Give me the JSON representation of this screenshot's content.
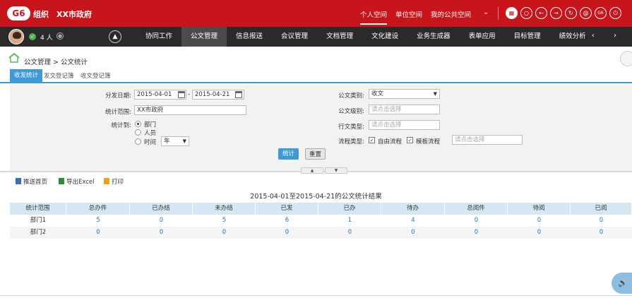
{
  "header": {
    "logo": "G6",
    "org_label": "组织",
    "org_name": "XX市政府",
    "links": [
      "个人空间",
      "单位空间",
      "我的公共空间"
    ],
    "caret": "⌄",
    "icons": [
      {
        "name": "grid-icon",
        "glyph": "▦"
      },
      {
        "name": "search-icon",
        "glyph": "○"
      },
      {
        "name": "back-icon",
        "glyph": "←"
      },
      {
        "name": "forward-icon",
        "glyph": "→"
      },
      {
        "name": "refresh-icon",
        "glyph": "↻"
      },
      {
        "name": "at-icon",
        "glyph": "@"
      },
      {
        "name": "g6-icon",
        "glyph": "G6"
      },
      {
        "name": "power-icon",
        "glyph": "⏻"
      }
    ]
  },
  "navbar": {
    "online_count": "4 人",
    "items": [
      "协同工作",
      "公文管理",
      "信息报送",
      "会议管理",
      "文档管理",
      "文化建设",
      "业务生成器",
      "表单应用",
      "目标管理",
      "绩效分析"
    ],
    "active_index": 1,
    "arrows": "‹ ›"
  },
  "breadcrumb": "公文管理 > 公文统计",
  "subtabs": [
    "收发统计",
    "发文登记簿",
    "收文登记簿"
  ],
  "filter": {
    "date_label": "分发日期:",
    "date_from": "2015-04-01",
    "date_sep": "-",
    "date_to": "2015-04-21",
    "range_label": "统计范围:",
    "range_value": "XX市政府",
    "stat_by_label": "统计到:",
    "stat_options": [
      "部门",
      "人员",
      "时间"
    ],
    "time_unit": "年",
    "doc_type_label": "公文类别:",
    "doc_type_value": "收文",
    "doc_level_label": "公文级别:",
    "doc_level_placeholder": "请点击选择",
    "office_type_label": "行文类型:",
    "office_type_placeholder": "请点击选择",
    "flow_type_label": "流程类型:",
    "flow_free": "自由流程",
    "flow_template": "模板流程",
    "flow_placeholder": "请点击选择",
    "stat_button": "统计",
    "reset_button": "重置"
  },
  "toolbar": {
    "push_home": "推送首页",
    "export_excel": "导出Excel",
    "print": "打印"
  },
  "result_title": "2015-04-01至2015-04-21的公文统计结果",
  "table": {
    "headers": [
      "统计范围",
      "总办件",
      "已办结",
      "未办结",
      "已发",
      "已办",
      "待办",
      "总阅件",
      "待阅",
      "已阅"
    ],
    "rows": [
      [
        "部门1",
        "5",
        "0",
        "5",
        "6",
        "1",
        "4",
        "0",
        "0",
        "0"
      ],
      [
        "部门2",
        "0",
        "0",
        "0",
        "0",
        "0",
        "0",
        "0",
        "0",
        "0"
      ]
    ]
  },
  "colors": {
    "brand_red": "#c8141b",
    "nav_dark": "#2a2a2a",
    "accent_blue": "#3d9ad6",
    "table_head": "#d6e7f4",
    "link_blue": "#2a6fb3"
  }
}
